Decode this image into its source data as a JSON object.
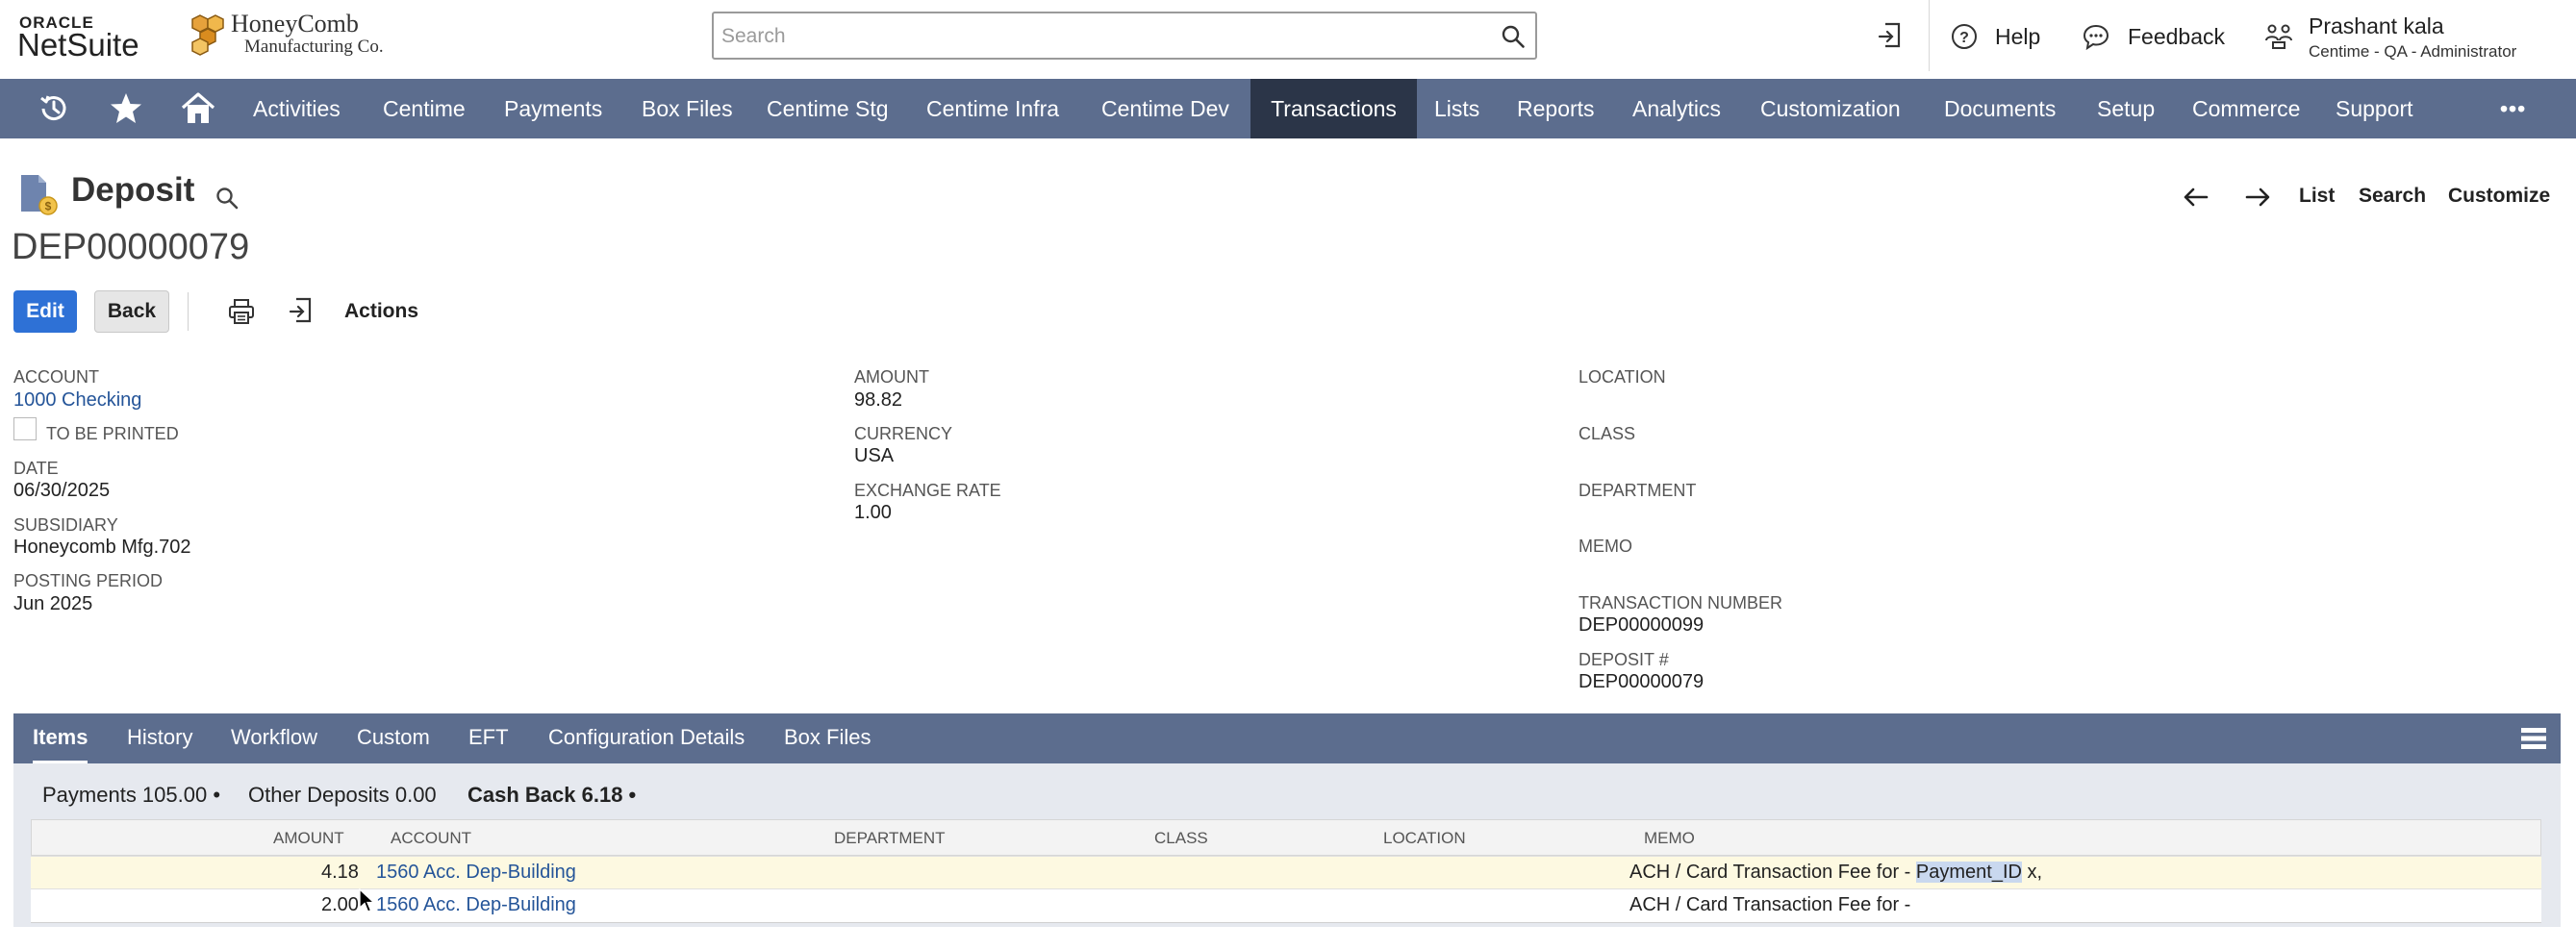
{
  "header": {
    "brand_oracle": "ORACLE",
    "brand_netsuite": "NetSuite",
    "company_name": "HoneyComb",
    "company_sub": "Manufacturing Co.",
    "search_placeholder": "Search",
    "help_label": "Help",
    "feedback_label": "Feedback",
    "user_name": "Prashant kala",
    "user_role": "Centime - QA - Administrator"
  },
  "nav": {
    "items": [
      "Activities",
      "Centime",
      "Payments",
      "Box Files",
      "Centime Stg",
      "Centime Infra",
      "Centime Dev",
      "Transactions",
      "Lists",
      "Reports",
      "Analytics",
      "Customization",
      "Documents",
      "Setup",
      "Commerce",
      "Support"
    ],
    "active": "Transactions",
    "more": "•••"
  },
  "record": {
    "type_title": "Deposit",
    "tran_id": "DEP00000079",
    "edit_label": "Edit",
    "back_label": "Back",
    "actions_label": "Actions",
    "right_nav": {
      "list": "List",
      "search": "Search",
      "customize": "Customize"
    }
  },
  "fields": {
    "account_label": "ACCOUNT",
    "account_value": "1000 Checking",
    "to_be_printed_label": "TO BE PRINTED",
    "date_label": "DATE",
    "date_value": "06/30/2025",
    "subsidiary_label": "SUBSIDIARY",
    "subsidiary_value": "Honeycomb Mfg.702",
    "posting_period_label": "POSTING PERIOD",
    "posting_period_value": "Jun 2025",
    "amount_label": "AMOUNT",
    "amount_value": "98.82",
    "currency_label": "CURRENCY",
    "currency_value": "USA",
    "exchange_rate_label": "EXCHANGE RATE",
    "exchange_rate_value": "1.00",
    "location_label": "LOCATION",
    "class_label": "CLASS",
    "department_label": "DEPARTMENT",
    "memo_label": "MEMO",
    "transaction_number_label": "TRANSACTION NUMBER",
    "transaction_number_value": "DEP00000099",
    "deposit_no_label": "DEPOSIT #",
    "deposit_no_value": "DEP00000079"
  },
  "subtabs": {
    "items": [
      "Items",
      "History",
      "Workflow",
      "Custom",
      "EFT",
      "Configuration Details",
      "Box Files"
    ],
    "active": "Items"
  },
  "sublist_tabs": {
    "payments": "Payments 105.00 •",
    "other_deposits": "Other Deposits 0.00",
    "cash_back": "Cash Back 6.18 •"
  },
  "cash_back_table": {
    "columns": {
      "amount": "AMOUNT",
      "account": "ACCOUNT",
      "department": "DEPARTMENT",
      "class": "CLASS",
      "location": "LOCATION",
      "memo": "MEMO"
    },
    "rows": [
      {
        "amount": "4.18",
        "account": "1560 Acc. Dep-Building",
        "memo_prefix": "ACH / Card Transaction Fee for - ",
        "memo_highlight": "Payment_ID",
        "memo_suffix": " x,"
      },
      {
        "amount": "2.00",
        "account": "1560 Acc. Dep-Building",
        "memo_prefix": "ACH / Card Transaction Fee for -",
        "memo_highlight": "",
        "memo_suffix": ""
      }
    ]
  },
  "colors": {
    "nav_bg": "#5c6d8e",
    "nav_active": "#2b3548",
    "link": "#255599",
    "edit_btn": "#2e71d6"
  }
}
